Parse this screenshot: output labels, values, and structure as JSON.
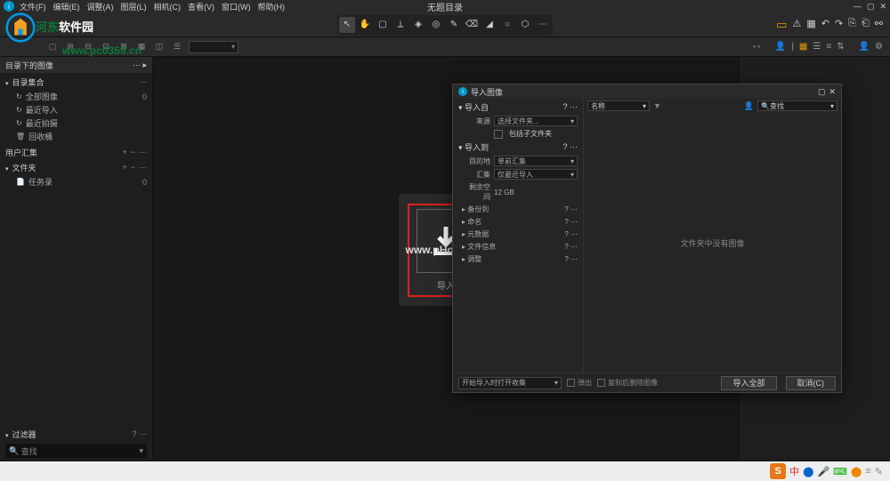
{
  "menubar": {
    "items": [
      "文件(F)",
      "编辑(E)",
      "调整(A)",
      "图层(L)",
      "相机(C)",
      "查看(V)",
      "窗口(W)",
      "帮助(H)"
    ],
    "title": "无题目录"
  },
  "brand": {
    "part1": "河东",
    "part2": "软件园",
    "url": "www.pc0359.cn"
  },
  "watermark": "www.pHome.NET",
  "leftPanel": {
    "header": "目录下的图像",
    "sections": {
      "catalog": {
        "title": "目录集合",
        "items": [
          {
            "icon": "↻",
            "label": "全部图像",
            "count": "0"
          },
          {
            "icon": "↻",
            "label": "最近导入",
            "count": ""
          },
          {
            "icon": "↻",
            "label": "最近拍摄",
            "count": ""
          },
          {
            "icon": "🗑",
            "label": "回收桶",
            "count": ""
          }
        ]
      },
      "user": {
        "title": "用户汇集"
      },
      "folder": {
        "title": "文件夹",
        "items": [
          {
            "icon": "📄",
            "label": "任务录",
            "count": "0"
          }
        ]
      }
    },
    "filter": {
      "title": "过滤器",
      "search_label": "查找"
    }
  },
  "importBox": {
    "label": "导入"
  },
  "dialog": {
    "title": "导入图像",
    "left": {
      "importFrom": {
        "title": "导入自",
        "rows": {
          "source": {
            "label": "来源",
            "value": "选择文件夹..."
          },
          "includeSub": {
            "label": "包括子文件夹"
          }
        }
      },
      "importTo": {
        "title": "导入到",
        "rows": {
          "dest": {
            "label": "目的地",
            "value": "单前汇集"
          },
          "collection": {
            "label": "汇集",
            "value": "仅最近导入"
          },
          "space": {
            "label": "剩余空间",
            "value": "12 GB"
          }
        }
      },
      "collapsed": [
        "备份到",
        "命名",
        "元数据",
        "文件信息",
        "调整"
      ]
    },
    "right": {
      "sort": {
        "label": "名称"
      },
      "search": {
        "label": "查找"
      },
      "empty": "文件夹中没有图像"
    },
    "footer": {
      "combo": "开始导入时打开收集",
      "eject": "弹出",
      "eraseAfter": "复制后删除图像",
      "importAll": "导入全部",
      "cancel": "取消(C)"
    }
  },
  "statusbar": {
    "ime": "中"
  }
}
